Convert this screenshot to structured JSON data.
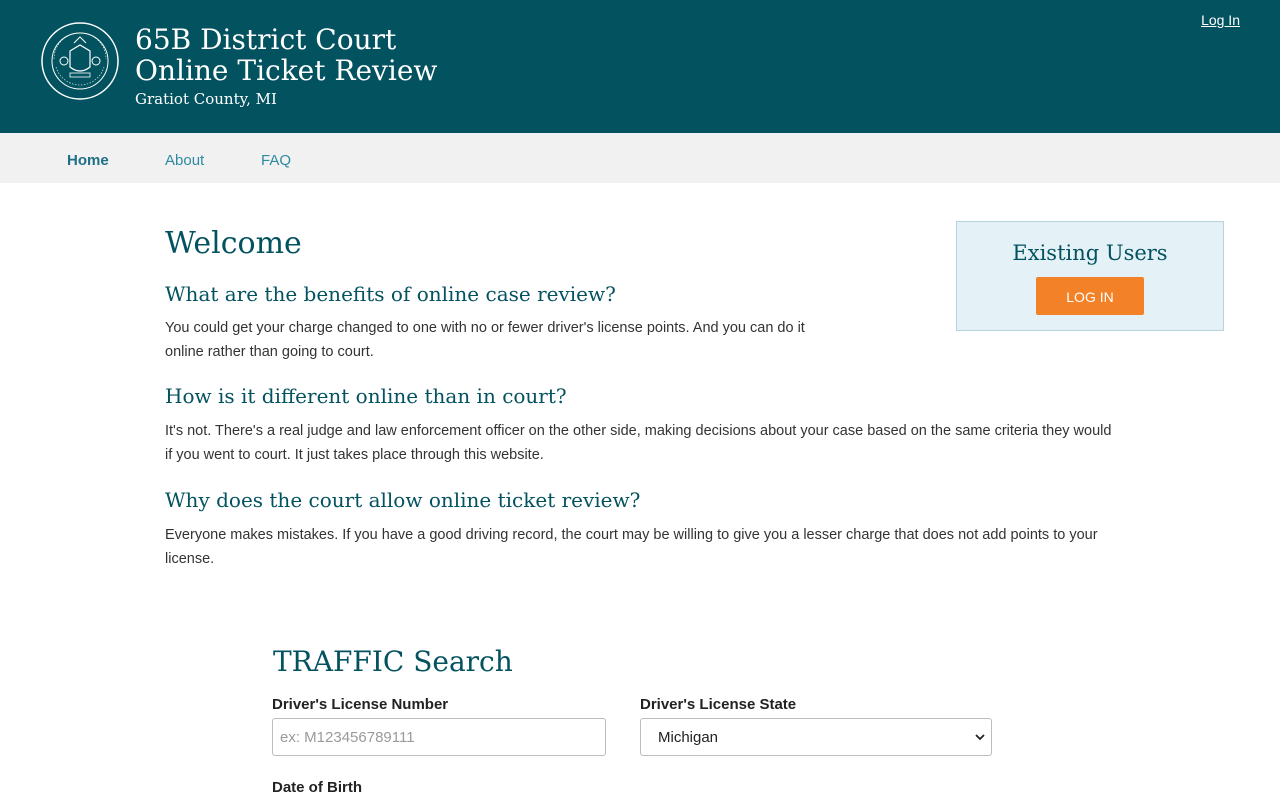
{
  "header": {
    "title_line1": "65B District Court",
    "title_line2": "Online Ticket Review",
    "subtitle": "Gratiot County, MI",
    "login_link": "Log In",
    "background_color": "#03525f",
    "seal_icon": "michigan-court-seal-icon"
  },
  "nav": {
    "items": [
      {
        "label": "Home",
        "active": true
      },
      {
        "label": "About",
        "active": false
      },
      {
        "label": "FAQ",
        "active": false
      }
    ]
  },
  "main": {
    "welcome": "Welcome",
    "sections": [
      {
        "question": "What are the benefits of online case review?",
        "answer": "You could get your charge changed to one with no or fewer driver's license points. And you can do it online rather than going to court."
      },
      {
        "question": "How is it different online than in court?",
        "answer": "It's not. There's a real judge and law enforcement officer on the other side, making decisions about your case based on the same criteria they would if you went to court. It just takes place through this website."
      },
      {
        "question": "Why does the court allow online ticket review?",
        "answer": "Everyone makes mistakes. If you have a good driving record, the court may be willing to give you a lesser charge that does not add points to your license."
      }
    ]
  },
  "existing_users": {
    "title": "Existing Users",
    "button_label": "LOG IN",
    "button_color": "#f28127"
  },
  "search": {
    "title": "TRAFFIC Search",
    "dl_label": "Driver's License Number",
    "dl_placeholder": "ex: M123456789111",
    "dl_value": "",
    "state_label": "Driver's License State",
    "state_value": "Michigan",
    "dob_label": "Date of Birth"
  }
}
